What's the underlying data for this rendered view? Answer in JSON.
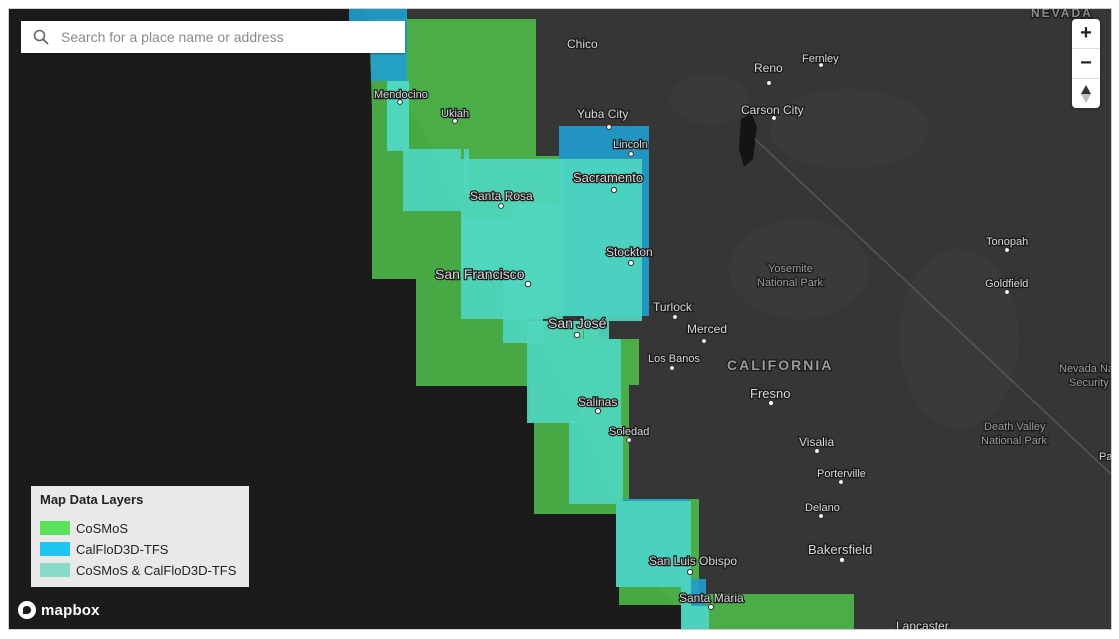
{
  "search": {
    "placeholder": "Search for a place name or address",
    "value": ""
  },
  "zoom_controls": {
    "zoom_in": "+",
    "zoom_out": "−",
    "compass": "▲"
  },
  "legend": {
    "title": "Map Data Layers",
    "items": [
      {
        "label": "CoSMoS",
        "color": "#5be35b"
      },
      {
        "label": "CalFloD3D-TFS",
        "color": "#1ec5f0"
      },
      {
        "label": "CoSMoS & CalFloD3D-TFS",
        "color": "#86dcc6"
      }
    ]
  },
  "attribution": {
    "logo_text": "mapbox"
  },
  "colors": {
    "base_land": "#363636",
    "base_water": "#1b1b1b",
    "cosmos": "#5be35b",
    "calflod": "#1ec5f0",
    "overlap": "#4fd6bf"
  },
  "places": {
    "nevada": "NEVADA",
    "chico": "Chico",
    "reno": "Reno",
    "fernley": "Fernley",
    "mendocino": "Mendocino",
    "ukiah": "Ukiah",
    "yuba_city": "Yuba City",
    "carson_city": "Carson City",
    "lincoln": "Lincoln",
    "sacramento": "Sacramento",
    "santa_rosa": "Santa Rosa",
    "stockton": "Stockton",
    "san_francisco": "San Francisco",
    "tonopah": "Tonopah",
    "yosemite1": "Yosemite",
    "yosemite2": "National Park",
    "goldfield": "Goldfield",
    "turlock": "Turlock",
    "san_jose": "San José",
    "merced": "Merced",
    "los_banos": "Los Banos",
    "california": "CALIFORNIA",
    "nevada_na1": "Nevada Na",
    "nevada_na2": "Security",
    "fresno": "Fresno",
    "salinas": "Salinas",
    "soledad": "Soledad",
    "death_valley1": "Death Valley",
    "death_valley2": "National Park",
    "pa": "Pa",
    "visalia": "Visalia",
    "porterville": "Porterville",
    "delano": "Delano",
    "bakersfield": "Bakersfield",
    "san_luis_obispo": "San Luis Obispo",
    "santa_maria": "Santa Maria",
    "lancaster": "Lancaster"
  }
}
